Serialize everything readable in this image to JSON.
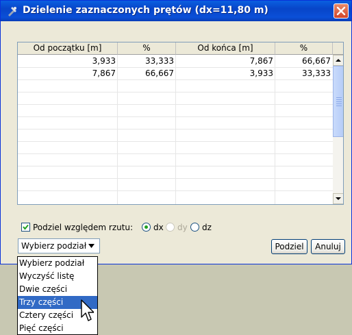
{
  "window": {
    "title": "Dzielenie zaznaczonych prętów (dx=11,80 m)"
  },
  "table": {
    "columns": [
      "Od początku [m]",
      "%",
      "Od końca [m]",
      "%"
    ],
    "rows": [
      [
        "3,933",
        "33,333",
        "7,867",
        "66,667"
      ],
      [
        "7,867",
        "66,667",
        "3,933",
        "33,333"
      ]
    ]
  },
  "options": {
    "checkbox_label": "Podziel względem rzutu:",
    "checked": true,
    "radios": [
      {
        "label": "dx",
        "selected": true,
        "enabled": true
      },
      {
        "label": "dy",
        "selected": false,
        "enabled": false
      },
      {
        "label": "dz",
        "selected": false,
        "enabled": true
      }
    ]
  },
  "combo": {
    "value": "Wybierz podział",
    "options": [
      "Wybierz podział",
      "Wyczyść listę",
      "Dwie części",
      "Trzy części",
      "Cztery części",
      "Pięć części"
    ],
    "highlighted": "Trzy części"
  },
  "buttons": {
    "split": "Podziel",
    "cancel": "Anuluj"
  },
  "colors": {
    "title_bar": "#0a4fd8",
    "selection": "#316ac5",
    "close": "#d3452a"
  }
}
